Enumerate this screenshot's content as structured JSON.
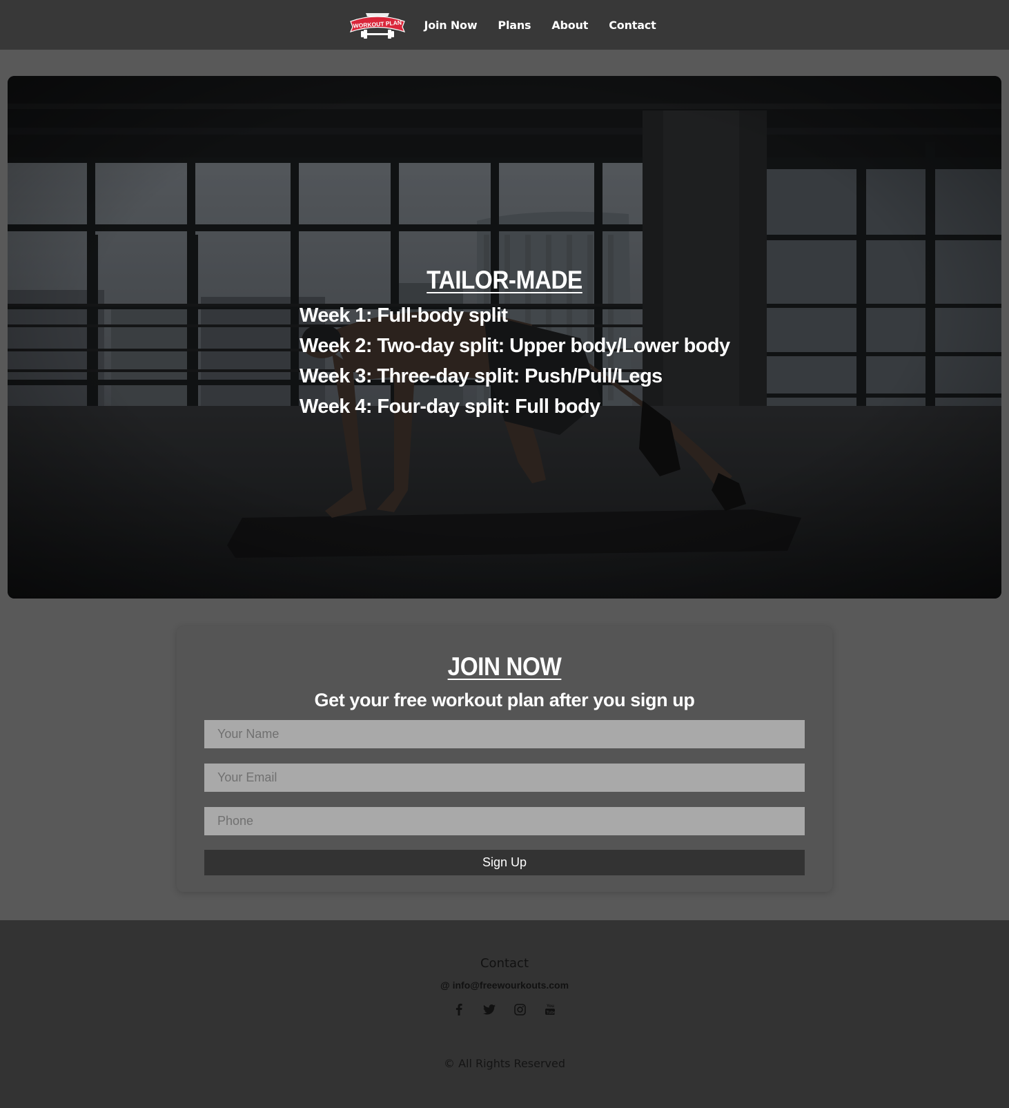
{
  "header": {
    "logo_alt": "Workout Plan logo",
    "nav": [
      {
        "label": "Join Now"
      },
      {
        "label": "Plans"
      },
      {
        "label": "About"
      },
      {
        "label": "Contact"
      }
    ]
  },
  "hero": {
    "title": "TAILOR-MADE",
    "weeks": [
      "Week 1: Full-body split",
      "Week 2: Two-day split: Upper body/Lower body",
      "Week 3: Three-day split: Push/Pull/Legs",
      "Week 4: Four-day split: Full body"
    ],
    "image_subject": "man doing mountain climbers on a mat in an empty gym loft"
  },
  "join": {
    "title": "JOIN NOW",
    "subtitle": "Get your free workout plan after you sign up",
    "name_placeholder": "Your Name",
    "email_placeholder": "Your Email",
    "phone_placeholder": "Phone",
    "submit_label": "Sign Up"
  },
  "footer": {
    "heading": "Contact",
    "email_symbol": "@",
    "email": "info@freewourkouts.com",
    "social_icons": [
      "facebook-icon",
      "twitter-icon",
      "instagram-icon",
      "youtube-icon"
    ],
    "copyright": "© All Rights Reserved"
  },
  "colors": {
    "page_bg": "#595959",
    "header_bg": "#383838",
    "card_bg": "#555555",
    "input_bg": "#a9a9a9",
    "button_bg": "#333333",
    "footer_bg": "#333333",
    "logo_red": "#d9263a"
  }
}
